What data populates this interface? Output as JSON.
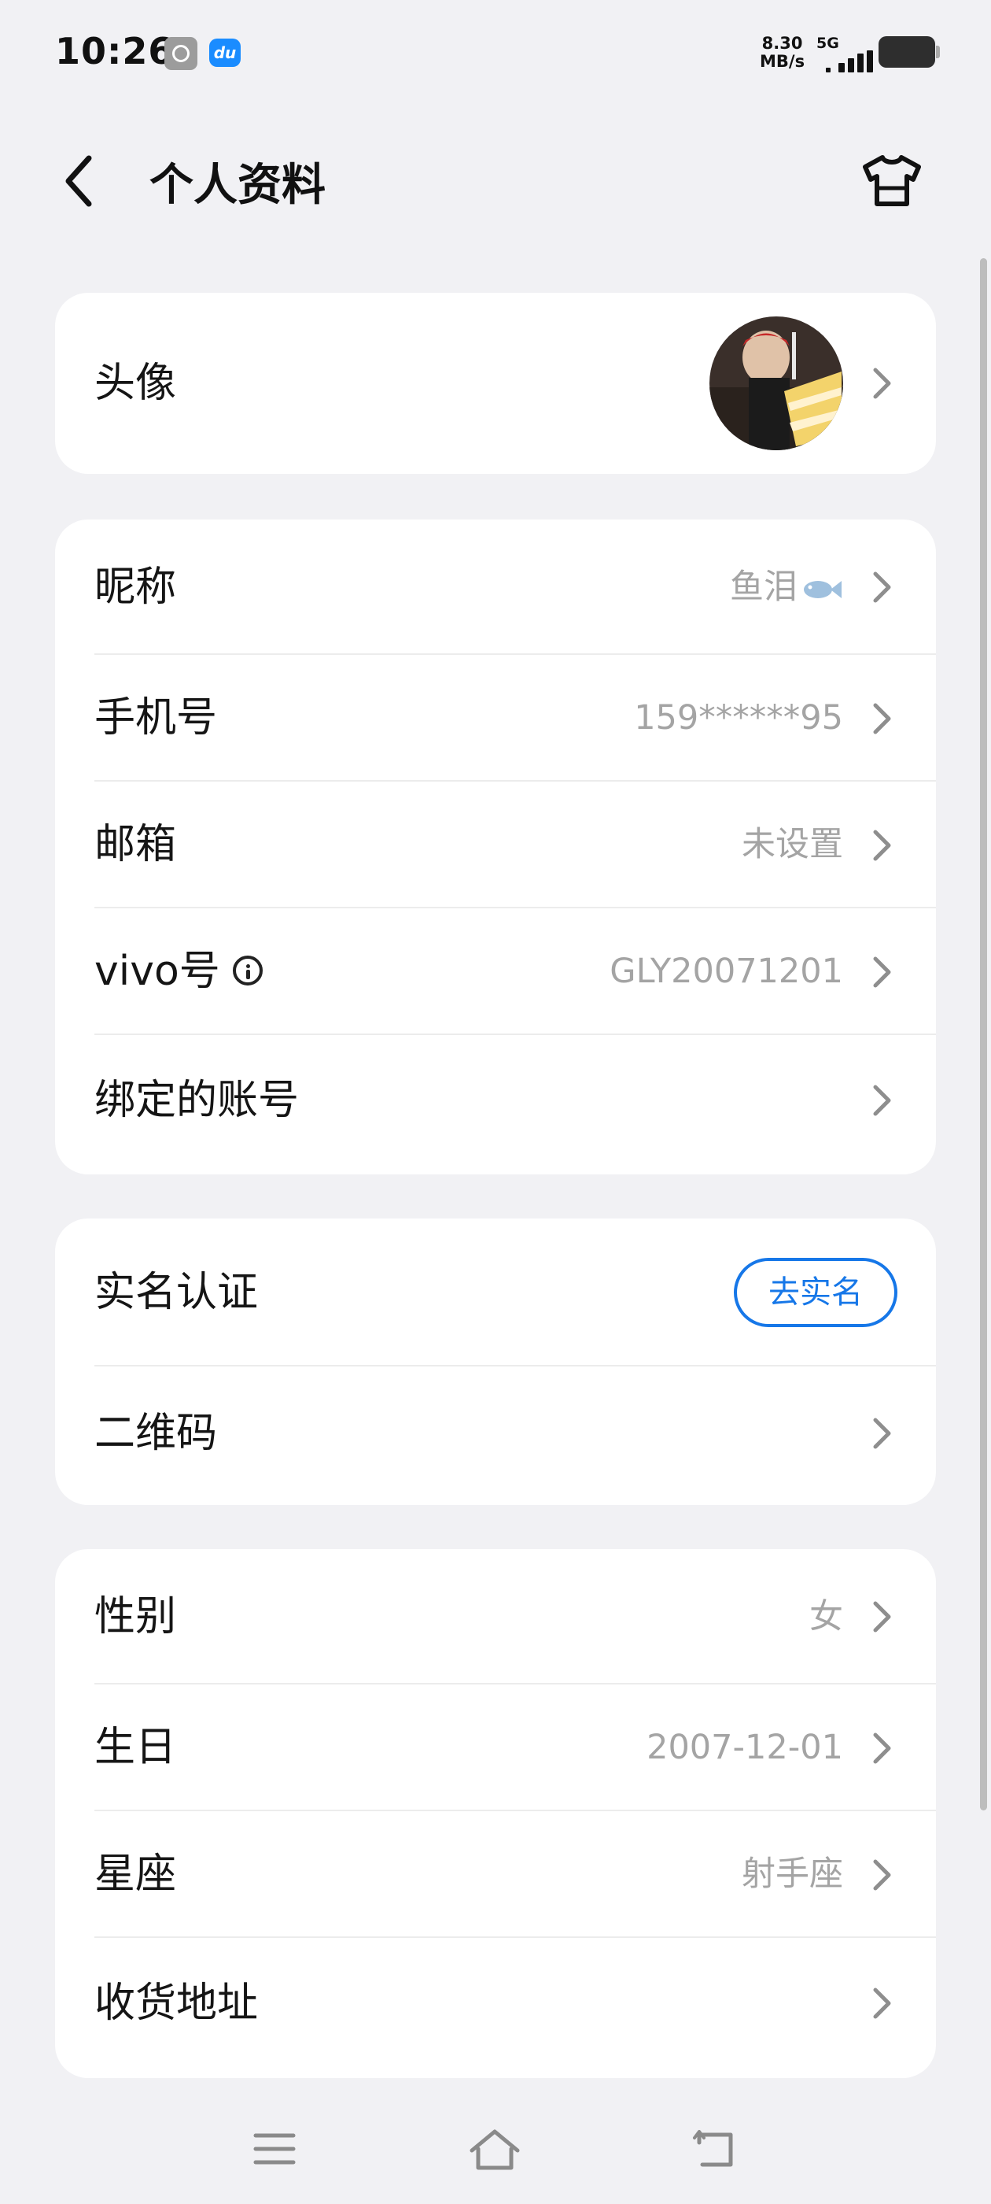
{
  "status_bar": {
    "time": "10:26",
    "speed_value": "8.30",
    "speed_unit": "MB/s",
    "network": "5G",
    "icons": [
      "settings-app-icon",
      "du-app-icon",
      "signal-icon",
      "battery-icon"
    ]
  },
  "header": {
    "title": "个人资料",
    "back_icon": "chevron-left-icon",
    "theme_icon": "tshirt-icon"
  },
  "card_avatar": {
    "label": "头像"
  },
  "card_account": {
    "nickname": {
      "label": "昵称",
      "value": "鱼泪"
    },
    "phone": {
      "label": "手机号",
      "value": "159******95"
    },
    "email": {
      "label": "邮箱",
      "value": "未设置"
    },
    "vivo_id": {
      "label": "vivo号",
      "value": "GLY20071201"
    },
    "bound_accounts": {
      "label": "绑定的账号"
    }
  },
  "card_identity": {
    "real_name": {
      "label": "实名认证",
      "button": "去实名"
    },
    "qr_code": {
      "label": "二维码"
    }
  },
  "card_personal": {
    "gender": {
      "label": "性别",
      "value": "女"
    },
    "birthday": {
      "label": "生日",
      "value": "2007-12-01"
    },
    "zodiac": {
      "label": "星座",
      "value": "射手座"
    },
    "address": {
      "label": "收货地址"
    }
  },
  "nav_bar": {
    "icons": [
      "menu-icon",
      "home-icon",
      "back-return-icon"
    ]
  },
  "colors": {
    "background": "#f1f1f4",
    "card": "#ffffff",
    "accent": "#1677e8",
    "secondary_text": "#a4a4a4"
  }
}
